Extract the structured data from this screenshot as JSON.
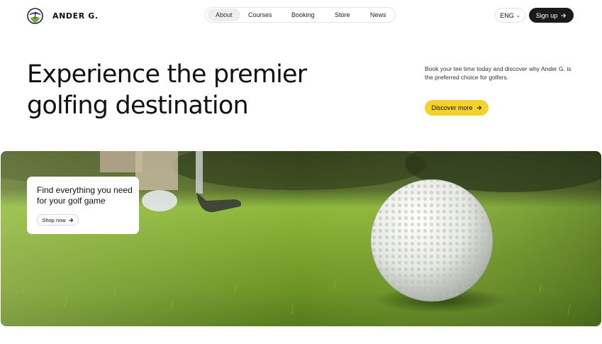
{
  "brand": {
    "name": "ANDER G."
  },
  "nav": {
    "items": [
      {
        "label": "About",
        "active": true
      },
      {
        "label": "Courses",
        "active": false
      },
      {
        "label": "Booking",
        "active": false
      },
      {
        "label": "Store",
        "active": false
      },
      {
        "label": "News",
        "active": false
      }
    ]
  },
  "header": {
    "language": "ENG",
    "signup_label": "Sign up"
  },
  "hero": {
    "title_line1": "Experience the premier",
    "title_line2": "golfing destination",
    "description": "Book your tee time today and discover why Ander G. is the preferred choice for golfers.",
    "cta_label": "Discover more"
  },
  "promo": {
    "title": "Find everything you need for your golf game",
    "cta_label": "Shop now"
  },
  "colors": {
    "accent": "#f5d22b",
    "dark": "#1a1a1a",
    "grass": "#7fae2c"
  },
  "icons": {
    "logo": "golf-logo-icon",
    "arrow": "arrow-right-icon",
    "chevron": "chevron-down-icon"
  }
}
